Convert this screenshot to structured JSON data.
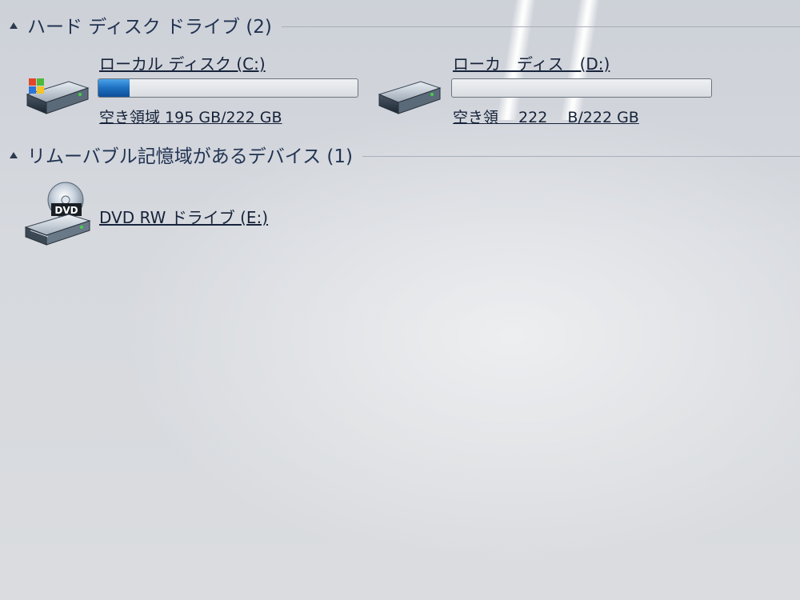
{
  "groups": {
    "hard_disks": {
      "title": "ハード ディスク ドライブ (2)"
    },
    "removable": {
      "title": "リムーバブル記憶域があるデバイス (1)"
    }
  },
  "drives": {
    "c": {
      "name": "ローカル ディスク (C:)",
      "free_text": "空き領域 195 GB/222 GB",
      "used_fraction": 0.12,
      "icon": "windows-hard-drive-icon"
    },
    "d": {
      "name": "ローカ　ディス　(D:)",
      "free_text": "空き領　 222 　B/222 GB",
      "used_fraction": 0.0,
      "icon": "hard-drive-icon"
    },
    "e": {
      "name": "DVD RW ドライブ (E:)",
      "icon": "dvd-drive-icon",
      "icon_label": "DVD"
    }
  },
  "colors": {
    "usage_bar": "#1d6fc0",
    "header_text": "#213352",
    "background": "#d6d9de"
  }
}
